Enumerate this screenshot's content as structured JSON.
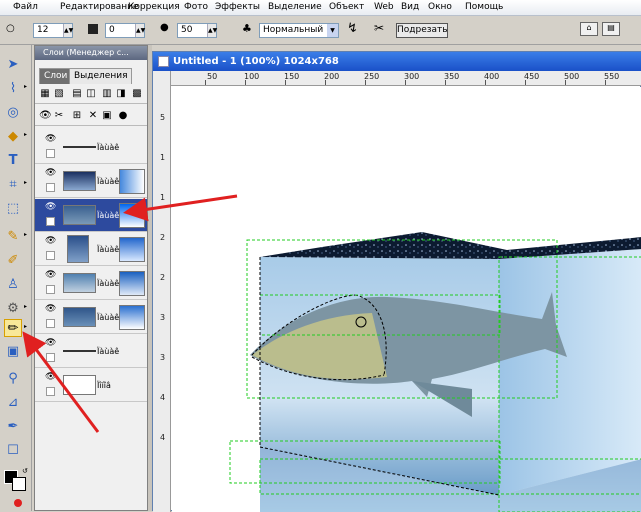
{
  "menu": [
    "Файл",
    "Редактирование",
    "Коррекция",
    "Фото",
    "Эффекты",
    "Выделение",
    "Объект",
    "Web",
    "Вид",
    "Окно",
    "Помощь"
  ],
  "options": {
    "size_value": "12",
    "opacity_value": "0",
    "hardness_value": "50",
    "blend_mode": "Нормальный",
    "crop_button": "Подрезать"
  },
  "panel": {
    "title": "Слои (Менеджер с...",
    "tab_layers": "Слои",
    "tab_selections": "Выделения",
    "layers": [
      {
        "name": "Ïàùàê"
      },
      {
        "name": "Ïàùàê"
      },
      {
        "name": "Ïàùàê"
      },
      {
        "name": "Ïàùàê"
      },
      {
        "name": "Ïàùàê"
      },
      {
        "name": "Ïàùàê"
      },
      {
        "name": "Ïàùàê"
      },
      {
        "name": "Ïîíîâ"
      }
    ]
  },
  "document": {
    "title": "Untitled - 1 (100%) 1024x768",
    "ruler_top": [
      "50",
      "100",
      "150",
      "200",
      "250",
      "300",
      "350",
      "400",
      "450",
      "500",
      "550"
    ],
    "ruler_left": [
      "5",
      "1",
      "1",
      "2",
      "2",
      "3",
      "3",
      "4",
      "4"
    ]
  },
  "colors": {
    "accent_title": "#1a50c8",
    "selected_layer": "#2d4a9e",
    "annotation_arrow": "#e02020",
    "selection_marquee": "#22cc22"
  }
}
